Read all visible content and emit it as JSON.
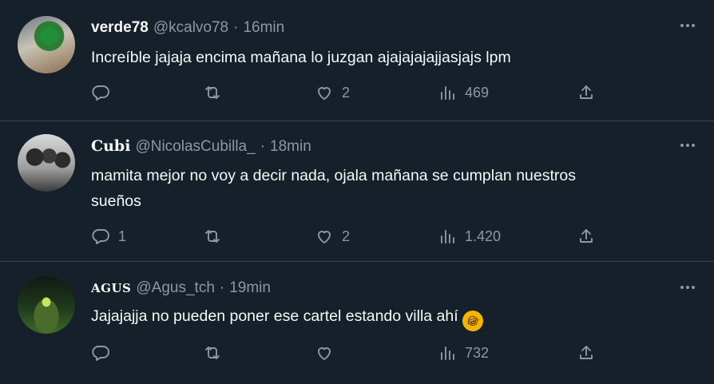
{
  "tweets": [
    {
      "name": "verde78",
      "handle": "@kcalvo78",
      "separator": "·",
      "time": "16min",
      "text": "Increíble jajaja encima mañana lo juzgan ajajajajajjasjajs lpm",
      "replies": "",
      "retweets": "",
      "likes": "2",
      "views": "469"
    },
    {
      "name": "Cubi",
      "handle": "@NicolasCubilla_",
      "separator": "·",
      "time": "18min",
      "text_line1": "mamita mejor no voy a decir nada, ojala mañana se cumplan nuestros",
      "text_line2": "sueños",
      "replies": "1",
      "retweets": "",
      "likes": "2",
      "views": "1.420"
    },
    {
      "name": "AGUS",
      "handle": "@Agus_tch",
      "separator": "·",
      "time": "19min",
      "text": "Jajajajja no pueden poner ese cartel estando villa ahí",
      "emoji": "rolling-on-floor-laughing",
      "emoji_glyph": "😂",
      "replies": "",
      "retweets": "",
      "likes": "",
      "views": "732"
    }
  ],
  "icons": {
    "reply": "reply-icon",
    "retweet": "retweet-icon",
    "like": "heart-icon",
    "views": "views-icon",
    "share": "share-icon",
    "more": "more-icon"
  },
  "colors": {
    "background": "#15202b",
    "text": "#f7f9f9",
    "muted": "#8b98a5",
    "border": "#38444d"
  }
}
